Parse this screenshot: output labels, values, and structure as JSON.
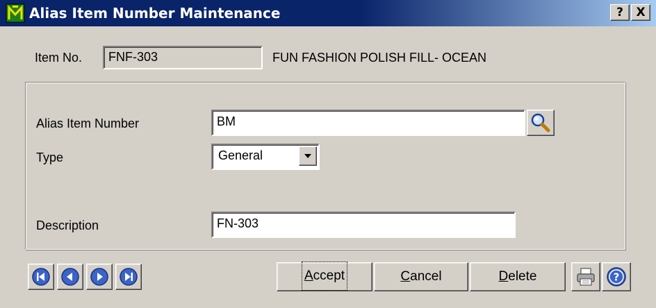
{
  "window": {
    "title": "Alias Item Number Maintenance",
    "help_button": "?",
    "close_button": "X"
  },
  "item": {
    "label": "Item No.",
    "value": "FNF-303",
    "description": "FUN FASHION POLISH FILL- OCEAN"
  },
  "form": {
    "alias_label": "Alias Item Number",
    "alias_value": "BM",
    "type_label": "Type",
    "type_value": "General",
    "description_label": "Description",
    "description_value": "FN-303"
  },
  "buttons": {
    "accept": {
      "pre": "",
      "underline": "A",
      "post": "ccept"
    },
    "cancel": {
      "pre": "",
      "underline": "C",
      "post": "ancel"
    },
    "delete": {
      "pre": "",
      "underline": "D",
      "post": "elete"
    }
  },
  "icons": {
    "app": "sage-m-icon",
    "lookup": "magnifier-icon",
    "nav": [
      "first-record-icon",
      "previous-record-icon",
      "next-record-icon",
      "last-record-icon"
    ],
    "print": "printer-icon",
    "help": "help-icon"
  },
  "colors": {
    "title_bar": "#0a246a",
    "dialog_face": "#d4d0c8",
    "nav_blue": "#3a64c8"
  }
}
